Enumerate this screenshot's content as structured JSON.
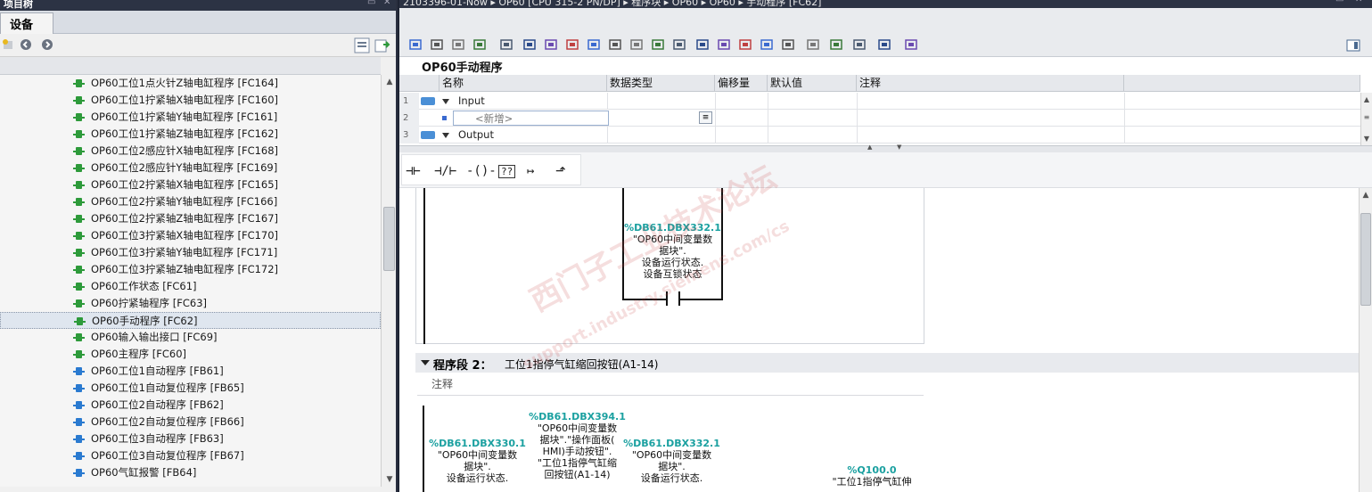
{
  "left_panel": {
    "title": "设备",
    "title_partial": "项目树",
    "tab_label": "设备",
    "tree_items": [
      {
        "label": "OP60工位1点火针Z轴电缸程序 [FC164]",
        "type": "fc"
      },
      {
        "label": "OP60工位1拧紧轴X轴电缸程序 [FC160]",
        "type": "fc"
      },
      {
        "label": "OP60工位1拧紧轴Y轴电缸程序 [FC161]",
        "type": "fc"
      },
      {
        "label": "OP60工位1拧紧轴Z轴电缸程序 [FC162]",
        "type": "fc"
      },
      {
        "label": "OP60工位2感应针X轴电缸程序 [FC168]",
        "type": "fc"
      },
      {
        "label": "OP60工位2感应针Y轴电缸程序 [FC169]",
        "type": "fc"
      },
      {
        "label": "OP60工位2拧紧轴X轴电缸程序 [FC165]",
        "type": "fc"
      },
      {
        "label": "OP60工位2拧紧轴Y轴电缸程序 [FC166]",
        "type": "fc"
      },
      {
        "label": "OP60工位2拧紧轴Z轴电缸程序 [FC167]",
        "type": "fc"
      },
      {
        "label": "OP60工位3拧紧轴X轴电缸程序 [FC170]",
        "type": "fc"
      },
      {
        "label": "OP60工位3拧紧轴Y轴电缸程序 [FC171]",
        "type": "fc"
      },
      {
        "label": "OP60工位3拧紧轴Z轴电缸程序 [FC172]",
        "type": "fc"
      },
      {
        "label": "OP60工作状态 [FC61]",
        "type": "fc"
      },
      {
        "label": "OP60拧紧轴程序 [FC63]",
        "type": "fc"
      },
      {
        "label": "OP60手动程序 [FC62]",
        "type": "fc",
        "selected": true
      },
      {
        "label": "OP60输入输出接口 [FC69]",
        "type": "fc"
      },
      {
        "label": "OP60主程序 [FC60]",
        "type": "fc"
      },
      {
        "label": "OP60工位1自动程序 [FB61]",
        "type": "fb"
      },
      {
        "label": "OP60工位1自动复位程序 [FB65]",
        "type": "fb"
      },
      {
        "label": "OP60工位2自动程序 [FB62]",
        "type": "fb"
      },
      {
        "label": "OP60工位2自动复位程序 [FB66]",
        "type": "fb"
      },
      {
        "label": "OP60工位3自动程序 [FB63]",
        "type": "fb"
      },
      {
        "label": "OP60工位3自动复位程序 [FB67]",
        "type": "fb"
      },
      {
        "label": "OP60气缸报警 [FB64]",
        "type": "fb"
      }
    ]
  },
  "editor": {
    "breadcrumb": "2103396-01-Now  ▸  OP60 [CPU 315-2 PN/DP]  ▸  程序块  ▸  OP60  ▸  OP60  ▸  手动程序 [FC62]",
    "block_name": "OP60手动程序",
    "interface": {
      "columns": [
        "名称",
        "数据类型",
        "偏移量",
        "默认值",
        "注释"
      ],
      "rows": [
        {
          "num": "1",
          "name": "Input",
          "kind": "section"
        },
        {
          "num": "2",
          "name": "<新增>",
          "kind": "new"
        },
        {
          "num": "3",
          "name": "Output",
          "kind": "section"
        }
      ]
    },
    "network1": {
      "operand_addr": "%DB61.DBX332.1",
      "operand_lines": [
        "\"OP60中间变量数",
        "据块\".",
        "设备运行状态.",
        "设备互锁状态"
      ]
    },
    "network2": {
      "title": "程序段 2：",
      "description": "工位1指停气缸缩回按钮(A1-14)",
      "comment": "注释",
      "op_a_addr": "%DB61.DBX330.1",
      "op_a_lines": [
        "\"OP60中间变量数",
        "据块\".",
        "设备运行状态."
      ],
      "op_b_addr": "%DB61.DBX394.1",
      "op_b_lines": [
        "\"OP60中间变量数",
        "据块\".\"操作面板(",
        "HMI)手动按钮\".",
        "\"工位1指停气缸缩",
        "回按钮(A1-14)"
      ],
      "op_c_addr": "%DB61.DBX332.1",
      "op_c_lines": [
        "\"OP60中间变量数",
        "据块\".",
        "设备运行状态."
      ],
      "op_d_addr": "%Q100.0",
      "op_d_lines": [
        "\"工位1指停气缸伸"
      ]
    },
    "watermark_text": "西门子工业技术论坛",
    "watermark_url": "support.industry.siemens.com/cs"
  }
}
